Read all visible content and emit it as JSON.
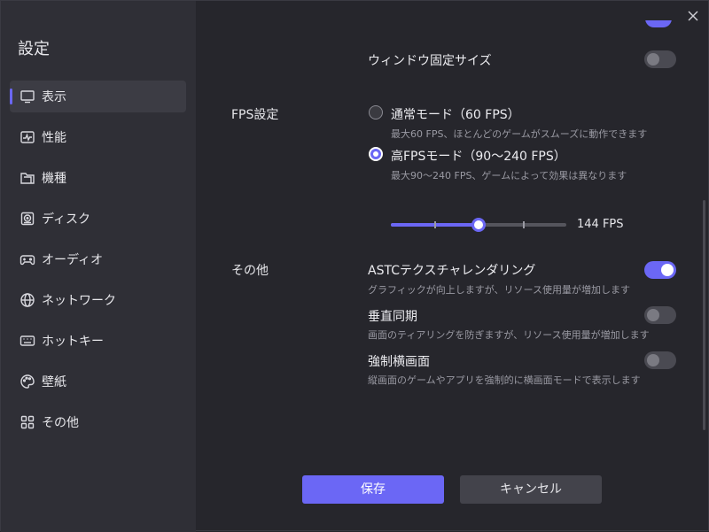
{
  "sidebar": {
    "title": "設定",
    "items": [
      {
        "label": "表示",
        "icon": "monitor-icon",
        "active": true
      },
      {
        "label": "性能",
        "icon": "performance-icon"
      },
      {
        "label": "機種",
        "icon": "folder-icon"
      },
      {
        "label": "ディスク",
        "icon": "disk-icon"
      },
      {
        "label": "オーディオ",
        "icon": "gamepad-icon"
      },
      {
        "label": "ネットワーク",
        "icon": "globe-icon"
      },
      {
        "label": "ホットキー",
        "icon": "keyboard-icon"
      },
      {
        "label": "壁紙",
        "icon": "palette-icon"
      },
      {
        "label": "その他",
        "icon": "grid-icon"
      }
    ]
  },
  "display": {
    "window_fixed_size": {
      "label": "ウィンドウ固定サイズ",
      "enabled": false
    }
  },
  "fps": {
    "section_label": "FPS設定",
    "normal": {
      "label": "通常モード（60 FPS）",
      "desc": "最大60 FPS、ほとんどのゲームがスムーズに動作できます",
      "selected": false
    },
    "high": {
      "label": "高FPSモード（90～240 FPS）",
      "desc": "最大90～240 FPS、ゲームによって効果は異なります",
      "selected": true
    },
    "slider": {
      "value_fraction": 0.5,
      "value_text": "144 FPS"
    }
  },
  "other": {
    "section_label": "その他",
    "astc": {
      "label": "ASTCテクスチャレンダリング",
      "desc": "グラフィックが向上しますが、リソース使用量が増加します",
      "enabled": true
    },
    "vsync": {
      "label": "垂直同期",
      "desc": "画面のティアリングを防ぎますが、リソース使用量が増加します",
      "enabled": false
    },
    "force_landscape": {
      "label": "強制横画面",
      "desc": "縦画面のゲームやアプリを強制的に横画面モードで表示します",
      "enabled": false
    }
  },
  "footer": {
    "save_label": "保存",
    "cancel_label": "キャンセル"
  },
  "colors": {
    "accent": "#6b67f5",
    "sidebar_bg": "#2f2f36",
    "main_bg": "#26262c"
  }
}
